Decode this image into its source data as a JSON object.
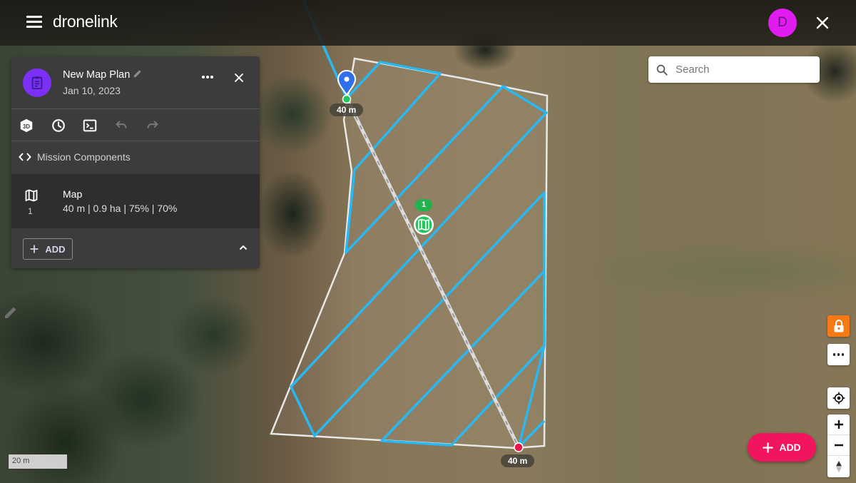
{
  "app": {
    "logo": "dronelink",
    "user_initial": "D",
    "menu_icon": "hamburger-menu-icon",
    "close_icon": "close-icon"
  },
  "search": {
    "placeholder": "Search",
    "value": ""
  },
  "plan": {
    "title": "New Map Plan",
    "date": "Jan 10, 2023",
    "avatar_icon": "clipboard-icon",
    "avatar_color": "#7b2ff7"
  },
  "toolbar": {
    "items": [
      {
        "name": "3d-view",
        "icon": "3d-cube-icon",
        "enabled": true
      },
      {
        "name": "history",
        "icon": "clock-icon",
        "enabled": true
      },
      {
        "name": "console",
        "icon": "terminal-icon",
        "enabled": true
      },
      {
        "name": "undo",
        "icon": "undo-icon",
        "enabled": false
      },
      {
        "name": "redo",
        "icon": "redo-icon",
        "enabled": false
      }
    ]
  },
  "components": {
    "header": "Mission Components",
    "items": [
      {
        "index": "1",
        "name": "Map",
        "details": "40 m | 0.9 ha | 75% | 70%",
        "icon": "map-icon"
      }
    ],
    "add_label": "ADD"
  },
  "map": {
    "start_altitude_label": "40 m",
    "end_altitude_label": "40 m",
    "component_badge": "1",
    "scale_label": "20 m",
    "path_color": "#29b8f0",
    "boundary_color": "#e8e8e8",
    "start_marker_color": "#2f6fec",
    "end_marker_color": "#e8174a"
  },
  "controls": {
    "lock_color": "#f57a14",
    "fab_label": "ADD",
    "fab_color": "#f0155c"
  }
}
